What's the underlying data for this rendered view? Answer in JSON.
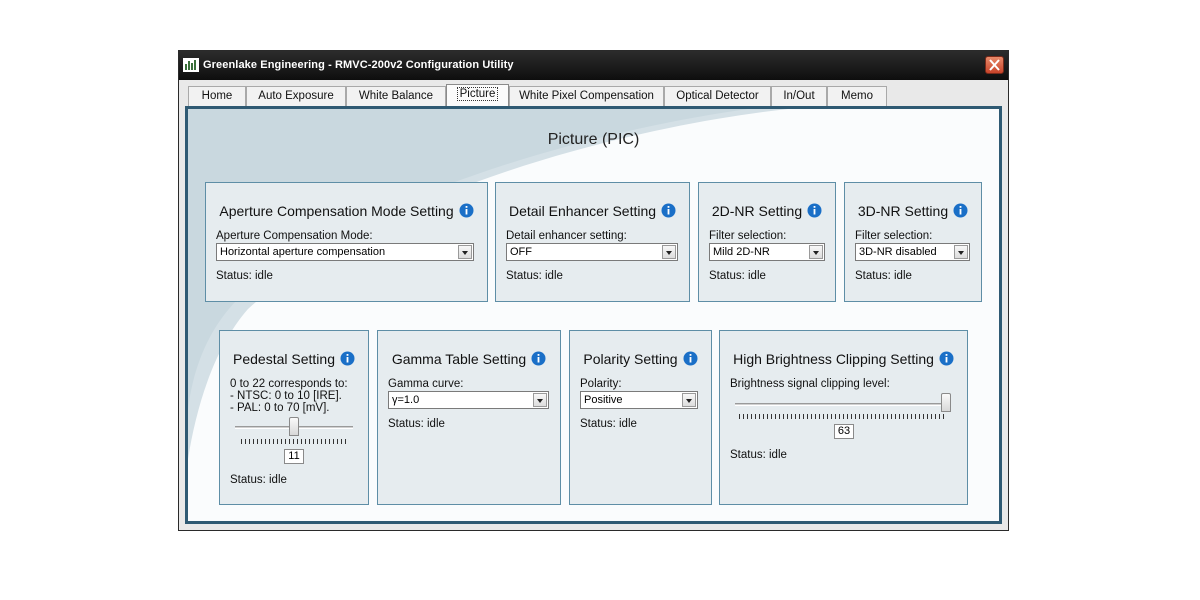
{
  "window": {
    "title": "Greenlake Engineering - RMVC-200v2 Configuration Utility"
  },
  "tabs": [
    "Home",
    "Auto Exposure",
    "White Balance",
    "Picture",
    "White Pixel Compensation",
    "Optical Detector",
    "In/Out",
    "Memo"
  ],
  "active_tab": "Picture",
  "page": {
    "title": "Picture (PIC)"
  },
  "colors": {
    "panel_border": "#2f5a73",
    "group_border": "#5e8ea6",
    "info_icon": "#1a6fc7",
    "close_button": "#c8442a"
  },
  "groups": {
    "aperture": {
      "title": "Aperture Compensation Mode Setting",
      "field_label": "Aperture Compensation Mode:",
      "value": "Horizontal aperture compensation",
      "status": "Status: idle"
    },
    "detail": {
      "title": "Detail Enhancer Setting",
      "field_label": "Detail enhancer setting:",
      "value": "OFF",
      "status": "Status: idle"
    },
    "nr2d": {
      "title": "2D-NR Setting",
      "field_label": "Filter selection:",
      "value": "Mild 2D-NR",
      "status": "Status: idle"
    },
    "nr3d": {
      "title": "3D-NR Setting",
      "field_label": "Filter selection:",
      "value": "3D-NR disabled",
      "status": "Status: idle"
    },
    "pedestal": {
      "title": "Pedestal Setting",
      "desc1": "0 to 22 corresponds to:",
      "desc2": "- NTSC: 0 to 10 [IRE].",
      "desc3": "- PAL: 0 to 70 [mV].",
      "value": "11",
      "level": 0.5,
      "status": "Status: idle"
    },
    "gamma": {
      "title": "Gamma Table Setting",
      "field_label": "Gamma curve:",
      "value": "γ=1.0",
      "status": "Status: idle"
    },
    "polarity": {
      "title": "Polarity Setting",
      "field_label": "Polarity:",
      "value": "Positive",
      "status": "Status: idle"
    },
    "clipping": {
      "title": "High Brightness Clipping Setting",
      "field_label": "Brightness signal clipping level:",
      "value": "63",
      "level": 1.0,
      "status": "Status: idle"
    }
  }
}
